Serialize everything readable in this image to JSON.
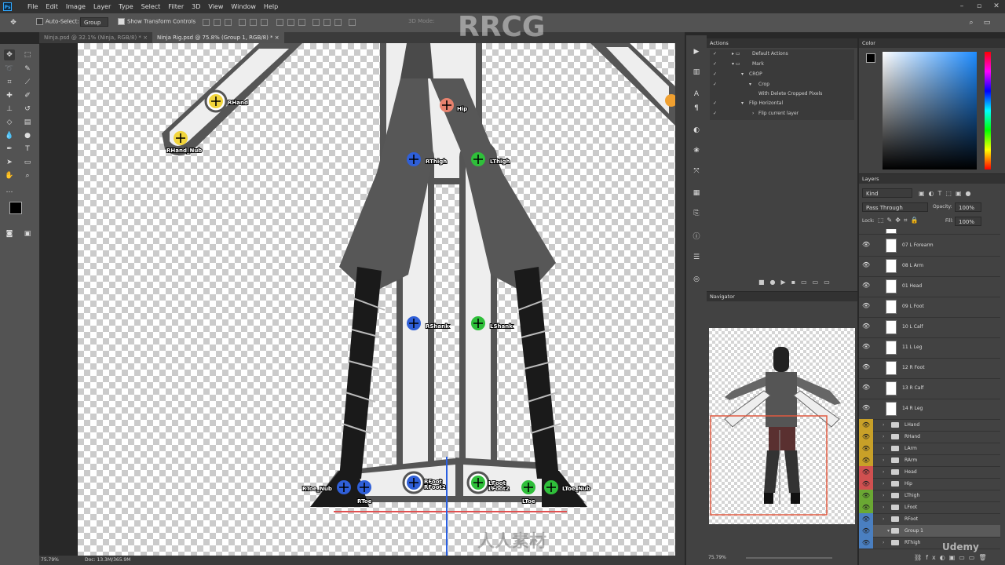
{
  "app": {
    "logo": "Ps"
  },
  "menu": [
    "File",
    "Edit",
    "Image",
    "Layer",
    "Type",
    "Select",
    "Filter",
    "3D",
    "View",
    "Window",
    "Help"
  ],
  "options": {
    "auto_select_label": "Auto-Select:",
    "auto_select_value": "Group",
    "show_transform": "Show Transform Controls",
    "mode_3d": "3D Mode:"
  },
  "tabs": [
    {
      "label": "Ninja.psd @ 32.1% (Ninja, RGB/8) *",
      "close": "×"
    },
    {
      "label": "Ninja Rig.psd @ 75.8% (Group 1, RGB/8) *",
      "close": "×"
    }
  ],
  "canvas": {
    "bones": {
      "rhand": "RHand",
      "rhand_nub": "RHand_Nub",
      "hip": "Hip",
      "rthigh": "RThigh",
      "lthigh": "LThigh",
      "rshank": "RShank",
      "lshank": "LShank",
      "rfoot": "RFoot",
      "rfoot2": "RFoot2",
      "lfoot": "LFoot",
      "lfoot2": "LFoot2",
      "rtoe": "RToe",
      "rtoe_nub": "RToe_Nub",
      "ltoe": "LToe",
      "ltoe_nub": "LToe_Nub"
    },
    "colors": {
      "yellow": "#f2d53c",
      "salmon": "#e8826e",
      "blue": "#2f5fd8",
      "green": "#2fbf3a",
      "orange": "#f0a030"
    }
  },
  "status": {
    "zoom": "75.79%",
    "doc": "Doc: 13.3M/365.9M"
  },
  "actions": {
    "title": "Actions",
    "items": [
      "Default Actions",
      "Mark",
      "CROP",
      "Crop",
      "With Delete Cropped Pixels",
      "Flip Horizontal",
      "Flip current layer"
    ]
  },
  "color": {
    "title": "Color"
  },
  "layers": {
    "title": "Layers",
    "kind": "Kind",
    "blend": "Pass Through",
    "opacity_label": "Opacity:",
    "opacity": "100%",
    "lock_label": "Lock:",
    "fill_label": "Fill:",
    "fill": "100%",
    "pixel_layers": [
      "07 L Forearm",
      "08 L Arm",
      "01 Head",
      "09 L Foot",
      "10 L Calf",
      "11 L Leg",
      "12 R Foot",
      "13 R Calf",
      "14 R Leg"
    ],
    "groups": [
      {
        "name": "LHand",
        "color": "#c8a028"
      },
      {
        "name": "RHand",
        "color": "#c8a028"
      },
      {
        "name": "LArm",
        "color": "#c8a028"
      },
      {
        "name": "RArm",
        "color": "#c8a028"
      },
      {
        "name": "Head",
        "color": "#d05050"
      },
      {
        "name": "Hip",
        "color": "#d05050"
      },
      {
        "name": "LThigh",
        "color": "#6aa833"
      },
      {
        "name": "LFoot",
        "color": "#6aa833"
      },
      {
        "name": "RFoot",
        "color": "#4a7fc0"
      },
      {
        "name": "Group 1",
        "color": "#4a7fc0"
      },
      {
        "name": "RThigh",
        "color": "#4a7fc0"
      }
    ]
  },
  "navigator": {
    "title": "Navigator",
    "zoom": "75.79%"
  },
  "watermarks": {
    "rrcg": "RRCG",
    "udemy": "Udemy",
    "renren": "人人素材"
  }
}
